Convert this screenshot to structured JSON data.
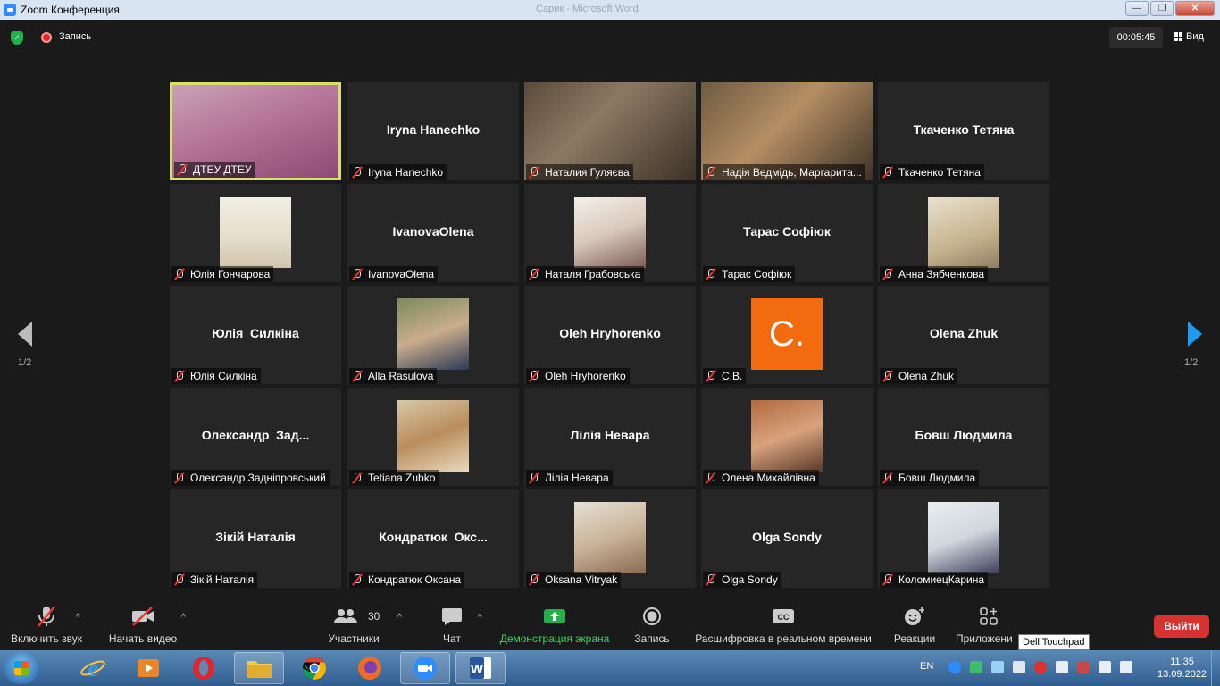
{
  "window": {
    "title": "Zoom Конференция",
    "ghost_title": "Сарик - Microsoft Word"
  },
  "topbar": {
    "recording_label": "Запись",
    "timer": "00:05:45",
    "view_label": "Вид"
  },
  "gallery": {
    "page_left": "1/2",
    "page_right": "1/2",
    "tiles": [
      {
        "big": "",
        "name": "ДТЕУ ДТЕУ",
        "type": "video-full"
      },
      {
        "big": "Iryna Hanechko",
        "name": "Iryna Hanechko",
        "type": "text"
      },
      {
        "big": "",
        "name": "Наталия Гуляєва",
        "type": "video-full"
      },
      {
        "big": "",
        "name": "Надія Ведмідь, Маргарита...",
        "type": "video-full"
      },
      {
        "big": "Ткаченко Тетяна",
        "name": "Ткаченко Тетяна",
        "type": "text"
      },
      {
        "big": "",
        "name": "Юлія Гончарова",
        "type": "photo"
      },
      {
        "big": "IvanovaOlena",
        "name": "IvanovaOlena",
        "type": "text"
      },
      {
        "big": "",
        "name": "Наталя Грабовська",
        "type": "photo"
      },
      {
        "big": "Тарас Софіюк",
        "name": "Тарас Софіюк",
        "type": "text"
      },
      {
        "big": "",
        "name": "Анна Зябченкова",
        "type": "photo"
      },
      {
        "big": "Юлія  Силкіна",
        "name": "Юлія Силкіна",
        "type": "text"
      },
      {
        "big": "",
        "name": "Alla Rasulova",
        "type": "photo"
      },
      {
        "big": "Oleh Hryhorenko",
        "name": "Oleh Hryhorenko",
        "type": "text"
      },
      {
        "big": "",
        "name": "С.В.",
        "type": "avatar",
        "avatar_letter": "С."
      },
      {
        "big": "Olena Zhuk",
        "name": "Olena Zhuk",
        "type": "text"
      },
      {
        "big": "Олександр  Зад...",
        "name": "Олександр Задніпровський",
        "type": "text"
      },
      {
        "big": "",
        "name": "Tetiana Zubko",
        "type": "photo"
      },
      {
        "big": "Лілія Невара",
        "name": "Лілія Невара",
        "type": "text"
      },
      {
        "big": "",
        "name": "Олена Михайлівна",
        "type": "photo"
      },
      {
        "big": "Бовш Людмила",
        "name": "Бовш Людмила",
        "type": "text"
      },
      {
        "big": "Зікій Наталія",
        "name": "Зікій Наталія",
        "type": "text"
      },
      {
        "big": "Кондратюк  Окс...",
        "name": "Кондратюк Оксана",
        "type": "text"
      },
      {
        "big": "",
        "name": "Oksana Vitryak",
        "type": "photo"
      },
      {
        "big": "Olga Sondy",
        "name": "Olga Sondy",
        "type": "text"
      },
      {
        "big": "",
        "name": "КоломиецКарина",
        "type": "photo"
      }
    ]
  },
  "toolbar": {
    "mute": "Включить звук",
    "video": "Начать видео",
    "participants": "Участники",
    "participants_count": "30",
    "chat": "Чат",
    "share": "Демонстрация экрана",
    "record": "Запись",
    "captions": "Расшифровка в реальном времени",
    "reactions": "Реакции",
    "apps": "Приложени",
    "leave": "Выйти",
    "tooltip": "Dell Touchpad"
  },
  "taskbar": {
    "lang": "EN",
    "time": "11:35",
    "date": "13.09.2022"
  },
  "colors": {
    "accent_green": "#3cd162",
    "leave_red": "#d6322f",
    "active_border": "#d6e06a",
    "avatar_orange": "#f26b0f"
  }
}
